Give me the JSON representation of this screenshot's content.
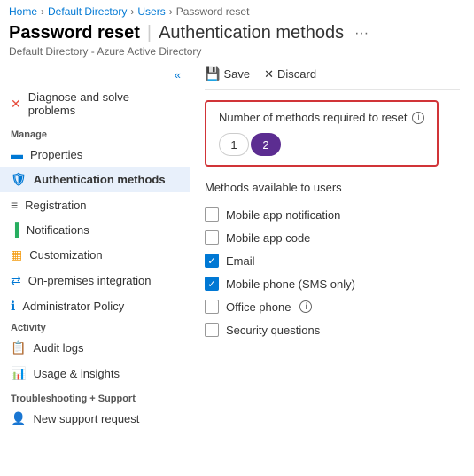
{
  "breadcrumb": {
    "items": [
      "Home",
      "Default Directory",
      "Users",
      "Password reset"
    ]
  },
  "page": {
    "title": "Password reset",
    "subtitle_separator": "|",
    "subtitle": "Authentication methods",
    "description": "Default Directory - Azure Active Directory",
    "ellipsis": "···"
  },
  "toolbar": {
    "save_label": "Save",
    "discard_label": "Discard"
  },
  "sidebar": {
    "collapse_icon": "«",
    "diagnose_label": "Diagnose and solve problems",
    "manage_label": "Manage",
    "items": [
      {
        "id": "properties",
        "label": "Properties"
      },
      {
        "id": "auth-methods",
        "label": "Authentication methods"
      },
      {
        "id": "registration",
        "label": "Registration"
      },
      {
        "id": "notifications",
        "label": "Notifications"
      },
      {
        "id": "customization",
        "label": "Customization"
      },
      {
        "id": "onprem",
        "label": "On-premises integration"
      },
      {
        "id": "policy",
        "label": "Administrator Policy"
      }
    ],
    "activity_label": "Activity",
    "activity_items": [
      {
        "id": "audit",
        "label": "Audit logs"
      },
      {
        "id": "usage",
        "label": "Usage & insights"
      }
    ],
    "support_label": "Troubleshooting + Support",
    "support_items": [
      {
        "id": "support",
        "label": "New support request"
      }
    ]
  },
  "content": {
    "methods_required_label": "Number of methods required to reset",
    "toggle_option1": "1",
    "toggle_option2": "2",
    "toggle_option1_state": "inactive",
    "toggle_option2_state": "active",
    "methods_available_title": "Methods available to users",
    "methods": [
      {
        "id": "mobile-app-notif",
        "label": "Mobile app notification",
        "checked": false
      },
      {
        "id": "mobile-app-code",
        "label": "Mobile app code",
        "checked": false
      },
      {
        "id": "email",
        "label": "Email",
        "checked": true
      },
      {
        "id": "mobile-phone",
        "label": "Mobile phone (SMS only)",
        "checked": true
      },
      {
        "id": "office-phone",
        "label": "Office phone",
        "checked": false,
        "has_info": true
      },
      {
        "id": "security-questions",
        "label": "Security questions",
        "checked": false
      }
    ]
  }
}
